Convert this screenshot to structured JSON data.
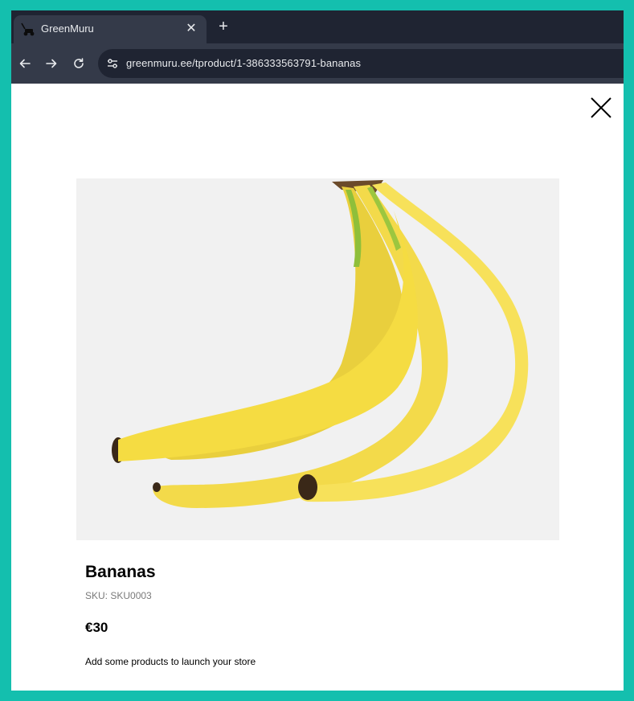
{
  "browser": {
    "tab_title": "GreenMuru",
    "tab_close": "✕",
    "new_tab": "+",
    "url": "greenmuru.ee/tproduct/1-386333563791-bananas"
  },
  "product": {
    "title": "Bananas",
    "sku": "SKU: SKU0003",
    "price": "€30",
    "description": "Add some products to launch your store",
    "image_icon": "bananas-photo"
  },
  "colors": {
    "frame": "#14bfae",
    "tabstrip": "#1f2432",
    "toolbar": "#343a49",
    "banana_yellow": "#f5dc42"
  }
}
